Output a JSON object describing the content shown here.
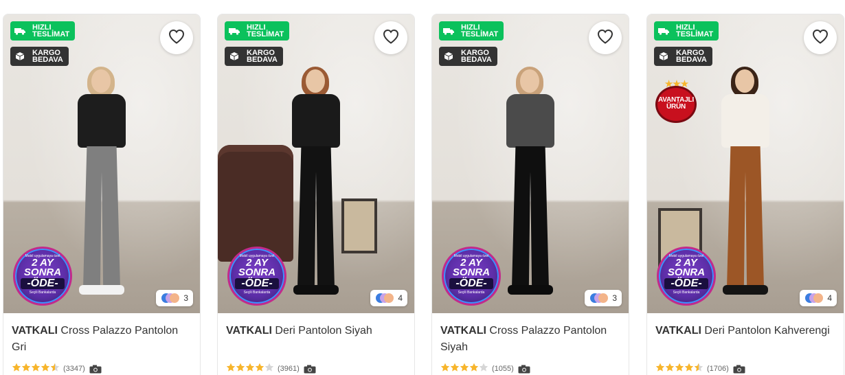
{
  "badges": {
    "fast_delivery": "HIZLI\nTESLİMAT",
    "free_cargo": "KARGO\nBEDAVA"
  },
  "pay_later": {
    "top_text": "Mobil uygulamaya özel",
    "line1": "2 AY",
    "line2": "SONRA",
    "line3": "-ÖDE-",
    "footer": "Seçili Bankalarda"
  },
  "advantage_badge": "AVANTAJLI\nÜRÜN",
  "products": [
    {
      "brand": "VATKALI",
      "name": "Cross Palazzo Pantolon Gri",
      "rating": 4.5,
      "review_count": "(3347)",
      "color_count": "3",
      "has_advantage": false,
      "top_color": "#1d1d1d",
      "pants_color": "#7f7f7f",
      "hair_color": "#d3b48b",
      "shoes_color": "#f2f2f2"
    },
    {
      "brand": "VATKALI",
      "name": "Deri Pantolon Siyah",
      "rating": 4,
      "review_count": "(3961)",
      "color_count": "4",
      "has_advantage": false,
      "top_color": "#1a1a1a",
      "pants_color": "#121212",
      "hair_color": "#9a5a34",
      "shoes_color": "#0e0e0e"
    },
    {
      "brand": "VATKALI",
      "name": "Cross Palazzo Pantolon Siyah",
      "rating": 4,
      "review_count": "(1055)",
      "color_count": "3",
      "has_advantage": false,
      "top_color": "#4b4b4b",
      "pants_color": "#0f0f0f",
      "hair_color": "#c9a27a",
      "shoes_color": "#0c0c0c"
    },
    {
      "brand": "VATKALI",
      "name": "Deri Pantolon Kahverengi",
      "rating": 4.5,
      "review_count": "(1706)",
      "color_count": "4",
      "has_advantage": true,
      "top_color": "#f3efe8",
      "pants_color": "#9c5626",
      "hair_color": "#3b2417",
      "shoes_color": "#141414"
    }
  ],
  "colors": {
    "fast_badge": "#0bc15c",
    "cargo_badge": "#333333",
    "star_filled": "#f7b52c",
    "star_empty": "#d6d6d6"
  }
}
